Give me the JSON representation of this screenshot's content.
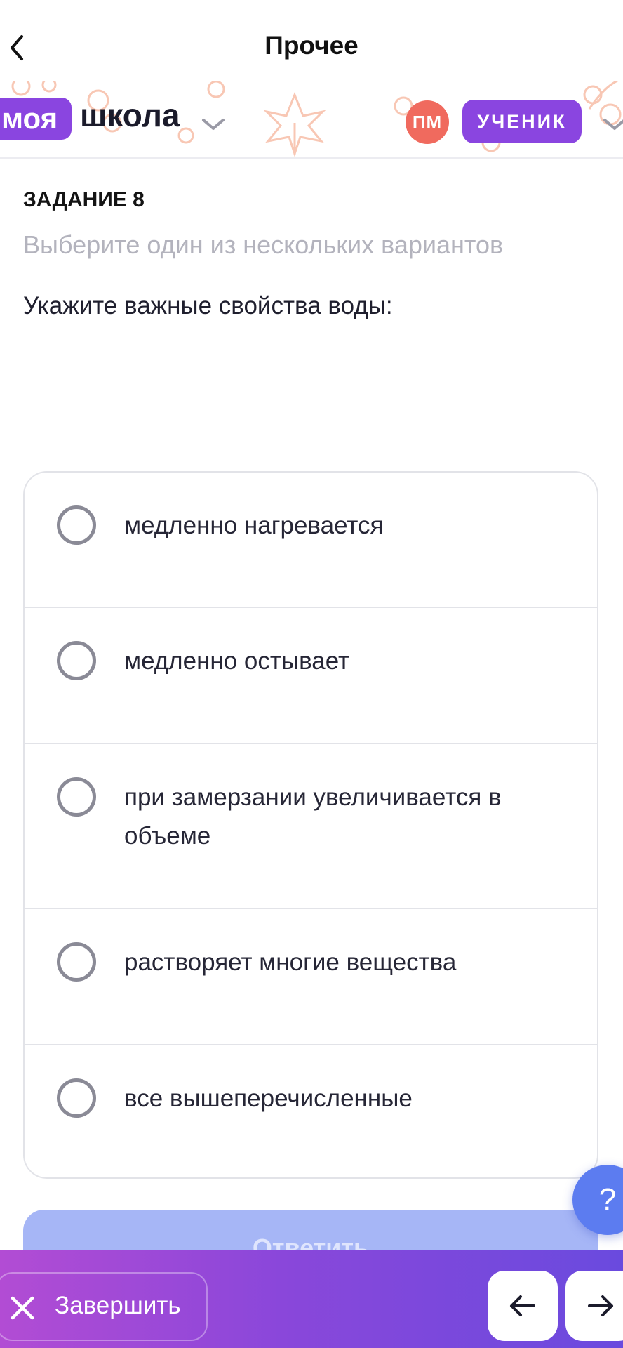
{
  "header": {
    "title": "Прочее",
    "back_icon": "chevron-left-icon"
  },
  "school": {
    "logo_part1": "моя",
    "logo_part2": "школа",
    "avatar_initials": "ПМ",
    "role": "УЧЕНИК",
    "colors": {
      "brand": "#8a45e0",
      "avatar": "#f06a5e",
      "decor": "#f8c7b4"
    }
  },
  "task": {
    "label": "ЗАДАНИЕ 8",
    "hint": "Выберите один из нескольких вариантов",
    "question": "Укажите важные свойства воды:",
    "options": [
      {
        "text": "медленно нагревается"
      },
      {
        "text": "медленно остывает"
      },
      {
        "text": "при замерзании увеличивается в объеме"
      },
      {
        "text": "растворяет многие вещества"
      },
      {
        "text": "все вышеперечисленные"
      }
    ]
  },
  "help": {
    "label": "?"
  },
  "answer_button": {
    "label": "Ответить",
    "color": "#a6b6f6"
  },
  "bottom": {
    "finish_label": "Завершить",
    "prev_icon": "arrow-left-icon",
    "next_icon": "arrow-right-icon"
  }
}
